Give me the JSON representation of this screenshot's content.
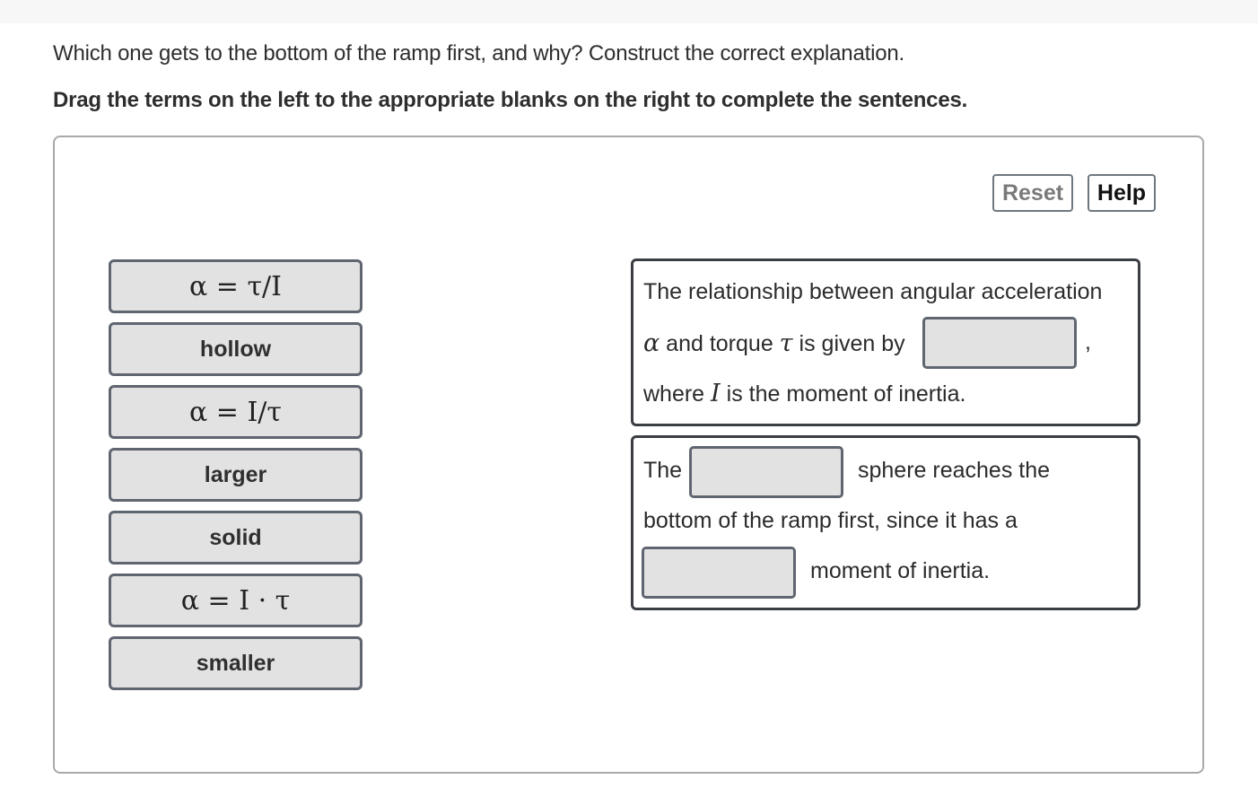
{
  "question": "Which one gets to the bottom of the ramp first, and why? Construct the correct explanation.",
  "instruction": "Drag the terms on the left to the appropriate blanks on the right to complete the sentences.",
  "buttons": {
    "reset": "Reset",
    "help": "Help"
  },
  "terms": [
    {
      "label": "α = τ/I",
      "math": true
    },
    {
      "label": "hollow",
      "math": false
    },
    {
      "label": "α = I/τ",
      "math": true
    },
    {
      "label": "larger",
      "math": false
    },
    {
      "label": "solid",
      "math": false
    },
    {
      "label": "α = I · τ",
      "math": true
    },
    {
      "label": "smaller",
      "math": false
    }
  ],
  "sentence1": {
    "line1": "The relationship between angular acceleration",
    "alpha": "α",
    "line2a": " and torque ",
    "tau": "τ",
    "line2b": " is given by",
    "comma": ",",
    "line3a": "where ",
    "I": "I",
    "line3b": " is the moment of inertia."
  },
  "sentence2": {
    "line1a": "The",
    "line1b": "sphere reaches the",
    "line2": "bottom of the ramp first, since it has a",
    "line3": "moment of inertia."
  }
}
